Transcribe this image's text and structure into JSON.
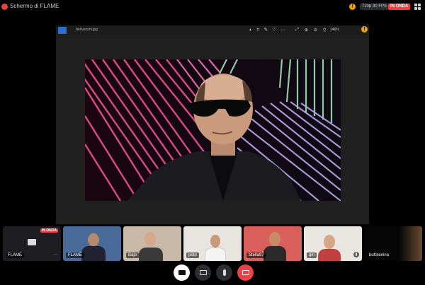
{
  "window": {
    "title": "Schermo di FLAME"
  },
  "header": {
    "quality": "720p 30 FPS",
    "live": "IN ONDA"
  },
  "viewer": {
    "file_name": "berlusconi.jpg",
    "zoom": "146%"
  },
  "participants": [
    {
      "name": "FLAME",
      "live": "IN ONDA"
    },
    {
      "name": "FLAME"
    },
    {
      "name": "Bajo"
    },
    {
      "name": "poto"
    },
    {
      "name": "Stella97"
    },
    {
      "name": "giri"
    },
    {
      "name": "bufotenina"
    }
  ],
  "colors": {
    "live": "#ed4245",
    "warn": "#f0a202",
    "hangup": "#ed4245"
  }
}
